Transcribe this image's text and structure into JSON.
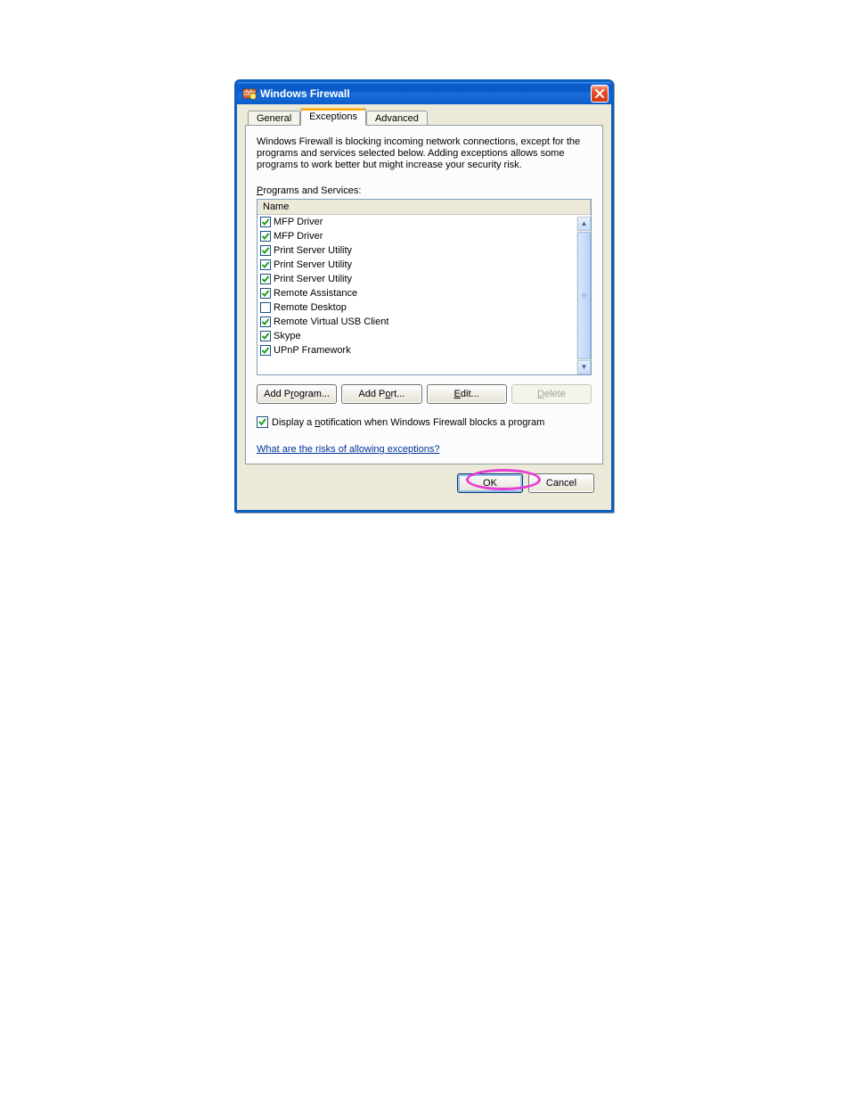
{
  "window": {
    "title": "Windows Firewall"
  },
  "tabs": {
    "general": "General",
    "exceptions": "Exceptions",
    "advanced": "Advanced",
    "active": "exceptions"
  },
  "description": "Windows Firewall is blocking incoming network connections, except for the programs and services selected below. Adding exceptions allows some programs to work better but might increase your security risk.",
  "list": {
    "label_prefix": "P",
    "label_rest": "rograms and Services:",
    "header": "Name",
    "items": [
      {
        "label": "MFP Driver",
        "checked": true
      },
      {
        "label": "MFP Driver",
        "checked": true
      },
      {
        "label": "Print Server Utility",
        "checked": true
      },
      {
        "label": "Print Server Utility",
        "checked": true
      },
      {
        "label": "Print Server Utility",
        "checked": true
      },
      {
        "label": "Remote Assistance",
        "checked": true
      },
      {
        "label": "Remote Desktop",
        "checked": false
      },
      {
        "label": "Remote Virtual USB Client",
        "checked": true
      },
      {
        "label": "Skype",
        "checked": true
      },
      {
        "label": "UPnP Framework",
        "checked": true
      }
    ]
  },
  "buttons": {
    "add_program_pre": "Add P",
    "add_program_ul": "r",
    "add_program_post": "ogram...",
    "add_port_pre": "Add P",
    "add_port_ul": "o",
    "add_port_post": "rt...",
    "edit_ul": "E",
    "edit_post": "dit...",
    "delete_ul": "D",
    "delete_post": "elete"
  },
  "notify": {
    "pre": "Display a ",
    "ul": "n",
    "post": "otification when Windows Firewall blocks a program",
    "checked": true
  },
  "link": "What are the risks of allowing exceptions?",
  "footer": {
    "ok": "OK",
    "cancel": "Cancel"
  }
}
